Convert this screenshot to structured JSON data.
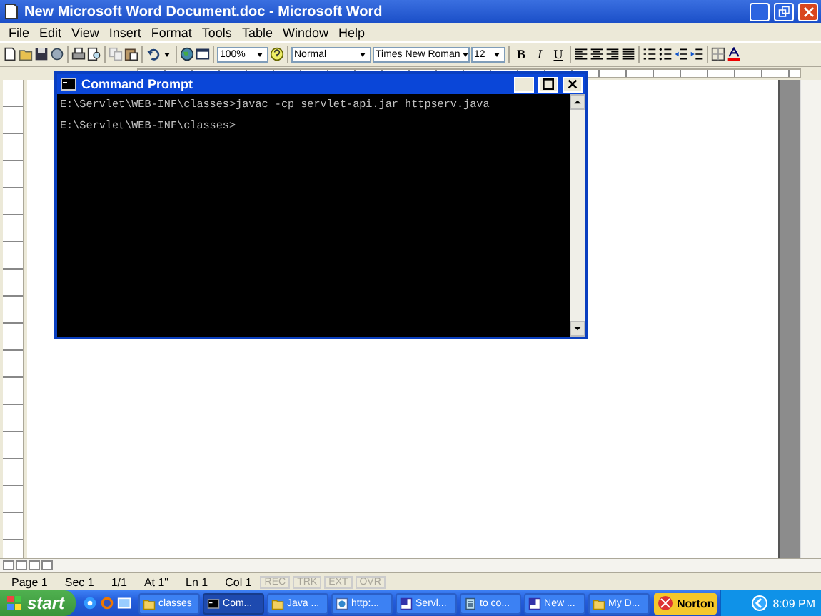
{
  "word": {
    "title": "New Microsoft Word Document.doc - Microsoft Word",
    "menu": [
      "File",
      "Edit",
      "View",
      "Insert",
      "Format",
      "Tools",
      "Table",
      "Window",
      "Help"
    ],
    "toolbar": {
      "zoom": "100%",
      "style": "Normal",
      "font": "Times New Roman",
      "size": "12",
      "format_buttons": [
        {
          "label": "B",
          "selected": false
        },
        {
          "label": "I",
          "selected": false
        },
        {
          "label": "U",
          "selected": false
        }
      ]
    },
    "status_bar": [
      {
        "text": "Page 1",
        "disabled": false
      },
      {
        "text": "Sec 1",
        "disabled": false
      },
      {
        "text": "1/1",
        "disabled": false
      },
      {
        "text": "At 1\"",
        "disabled": false
      },
      {
        "text": "Ln 1",
        "disabled": false
      },
      {
        "text": "Col 1",
        "disabled": false
      },
      {
        "text": "REC",
        "disabled": true
      },
      {
        "text": "TRK",
        "disabled": true
      },
      {
        "text": "EXT",
        "disabled": true
      },
      {
        "text": "OVR",
        "disabled": true
      }
    ]
  },
  "command_prompt": {
    "title": "Command Prompt",
    "lines": [
      "E:\\Servlet\\WEB-INF\\classes>javac -cp servlet-api.jar httpserv.java",
      "E:\\Servlet\\WEB-INF\\classes>"
    ]
  },
  "taskbar": {
    "start": "start",
    "buttons": [
      {
        "label": "classes",
        "selected": false
      },
      {
        "label": "Com...",
        "selected": true
      },
      {
        "label": "Java ...",
        "selected": false
      },
      {
        "label": "http:...",
        "selected": false
      },
      {
        "label": "Servl...",
        "selected": false
      },
      {
        "label": "to co...",
        "selected": false
      },
      {
        "label": "New ...",
        "selected": false
      },
      {
        "label": "My D...",
        "selected": false
      }
    ],
    "tray": {
      "norton": "Norton",
      "clock": "8:09 PM"
    }
  }
}
